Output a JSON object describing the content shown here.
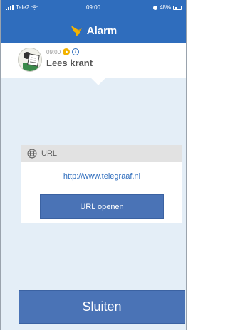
{
  "status_bar": {
    "carrier": "Tele2",
    "time": "09:00",
    "battery": "48%"
  },
  "header": {
    "title": "Alarm",
    "icon": "bird-icon",
    "color": "#2f6dbd"
  },
  "activity": {
    "time": "09:00",
    "title": "Lees krant",
    "avatar_icon": "reading-newspaper-icon",
    "play_icon": "play-icon",
    "info_icon": "info-icon"
  },
  "url_section": {
    "label": "URL",
    "icon": "globe-icon",
    "link": "http://www.telegraaf.nl",
    "open_button": "URL openen"
  },
  "footer": {
    "close_button": "Sluiten"
  },
  "colors": {
    "accent": "#2f6dbd",
    "button": "#4a73b6",
    "play": "#f3b300",
    "content_bg": "#e4eef7"
  }
}
